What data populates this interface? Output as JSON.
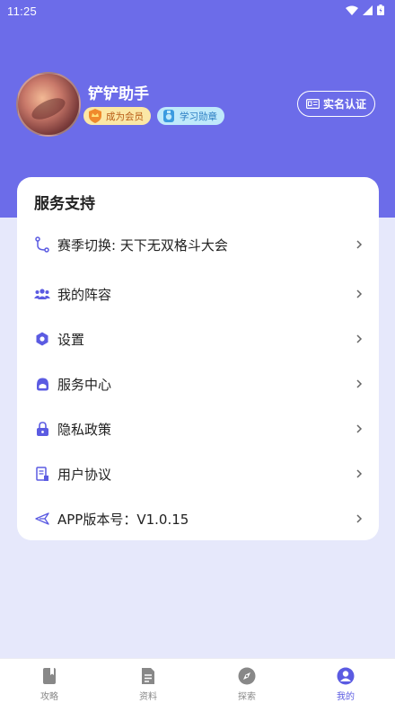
{
  "status_bar": {
    "time": "11:25"
  },
  "colors": {
    "accent": "#6c6ce9",
    "background": "#e6e8fb",
    "tab_active": "#5b5be2",
    "tab_inactive": "#888888"
  },
  "profile": {
    "name": "铲铲助手",
    "badges": [
      {
        "label": "成为会员",
        "icon": "crown-shield-icon"
      },
      {
        "label": "学习勋章",
        "icon": "medal-icon"
      }
    ],
    "verify_button": "实名认证"
  },
  "service": {
    "title": "服务支持",
    "items": [
      {
        "label": "赛季切换: 天下无双格斗大会",
        "icon": "season-switch-icon"
      },
      {
        "label": "我的阵容",
        "icon": "team-icon"
      },
      {
        "label": "设置",
        "icon": "settings-icon"
      },
      {
        "label": "服务中心",
        "icon": "headset-icon"
      },
      {
        "label": "隐私政策",
        "icon": "lock-icon"
      },
      {
        "label": "用户协议",
        "icon": "document-icon"
      },
      {
        "label": "APP版本号：V1.0.15",
        "icon": "send-icon"
      }
    ]
  },
  "tabs": [
    {
      "label": "攻略",
      "icon": "book-icon"
    },
    {
      "label": "资料",
      "icon": "file-icon"
    },
    {
      "label": "探索",
      "icon": "compass-icon"
    },
    {
      "label": "我的",
      "icon": "user-icon",
      "active": true
    }
  ]
}
